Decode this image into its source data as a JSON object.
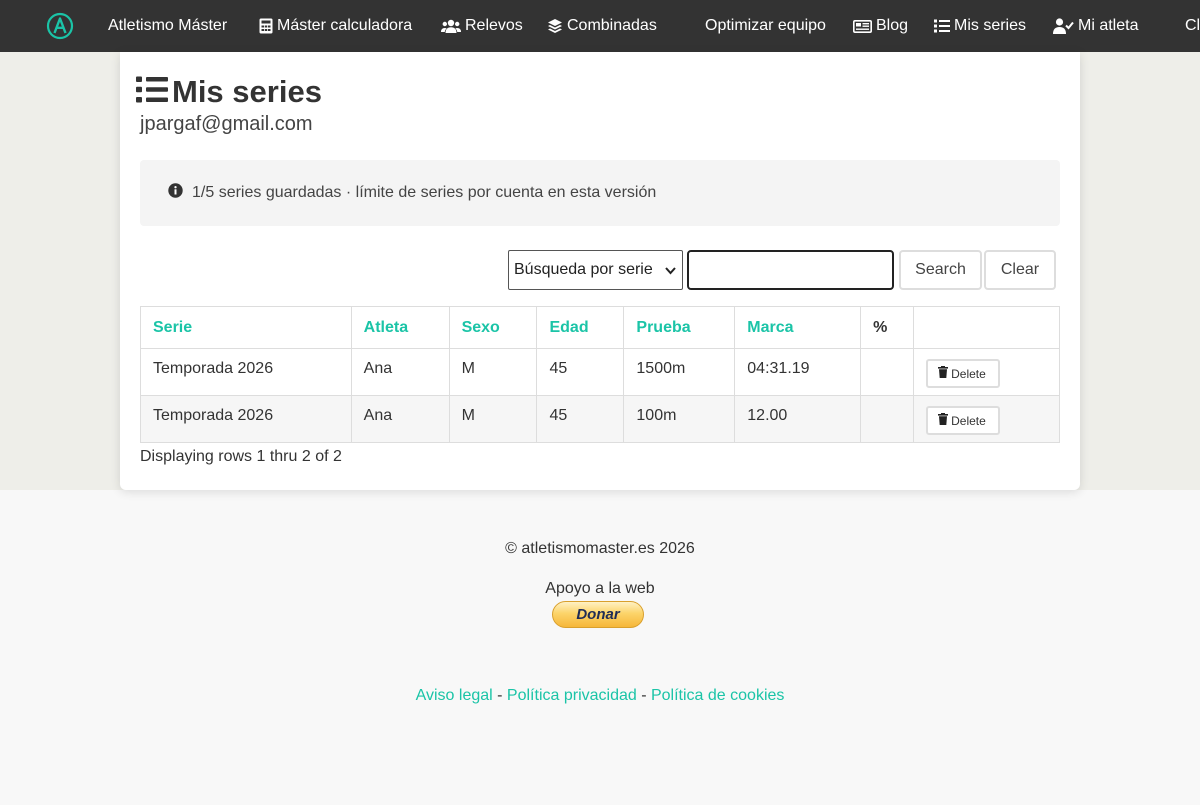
{
  "nav": {
    "brand": "Atletismo Máster",
    "items": [
      {
        "label": "Máster calculadora",
        "icon": "calculator-icon"
      },
      {
        "label": "Relevos",
        "icon": "users-icon"
      },
      {
        "label": "Combinadas",
        "icon": "layers-icon"
      },
      {
        "label": "Optimizar equipo",
        "icon": ""
      },
      {
        "label": "Blog",
        "icon": "newspaper-icon"
      },
      {
        "label": "Mis series",
        "icon": "list-icon"
      },
      {
        "label": "Mi atleta",
        "icon": "user-check-icon"
      },
      {
        "label": "Cl",
        "icon": ""
      }
    ]
  },
  "page": {
    "title": "Mis series",
    "email": "jpargaf@gmail.com",
    "alert": "1/5 series guardadas · límite de series por cuenta en esta versión"
  },
  "search": {
    "select_value": "Búsqueda por serie",
    "input_value": "",
    "search_label": "Search",
    "clear_label": "Clear"
  },
  "table": {
    "headers": [
      "Serie",
      "Atleta",
      "Sexo",
      "Edad",
      "Prueba",
      "Marca",
      "%",
      ""
    ],
    "rows": [
      {
        "serie": "Temporada 2026",
        "atleta": "Ana",
        "sexo": "M",
        "edad": "45",
        "prueba": "1500m",
        "marca": "04:31.19",
        "pct": "",
        "action": "Delete"
      },
      {
        "serie": "Temporada 2026",
        "atleta": "Ana",
        "sexo": "M",
        "edad": "45",
        "prueba": "100m",
        "marca": "12.00",
        "pct": "",
        "action": "Delete"
      }
    ],
    "display_info": "Displaying rows 1 thru 2 of 2"
  },
  "footer": {
    "copyright": "© atletismomaster.es 2026",
    "support": "Apoyo a la web",
    "donate": "Donar",
    "link_legal": "Aviso legal",
    "link_privacy": "Política privacidad",
    "link_cookies": "Política de cookies",
    "separator": " - "
  },
  "colors": {
    "accent": "#1bc4a7",
    "navbar": "#333333",
    "band": "#eeeee9"
  }
}
